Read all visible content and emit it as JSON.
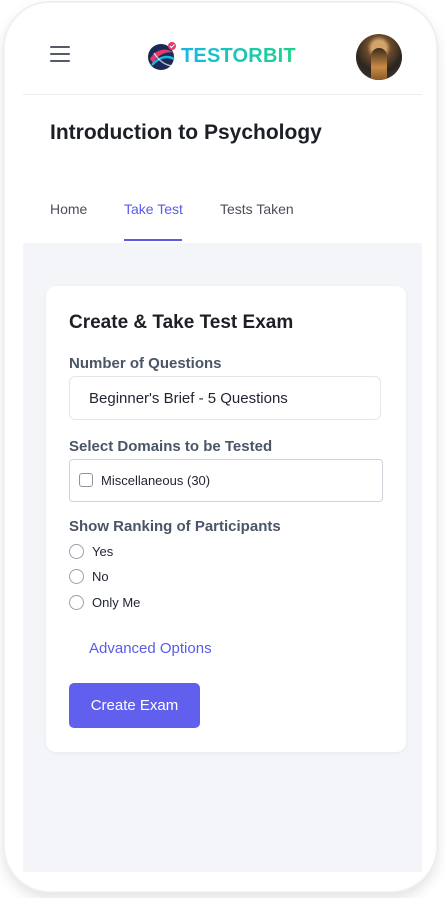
{
  "app": {
    "brand": "TESTORBIT"
  },
  "icons": {
    "menu": "hamburger-menu-icon",
    "logo": "testorbit-logo-icon",
    "avatar": "user-avatar"
  },
  "colors": {
    "accent": "#5b5be8",
    "button": "#6160ee",
    "logo_gradient_start": "#15b8e6",
    "logo_gradient_end": "#1fd38a"
  },
  "header": {
    "course_title": "Introduction to Psychology",
    "tabs": [
      {
        "label": "Home",
        "active": false
      },
      {
        "label": "Take Test",
        "active": true
      },
      {
        "label": "Tests Taken",
        "active": false
      }
    ]
  },
  "form": {
    "title": "Create & Take Test Exam",
    "questions_label": "Number of Questions",
    "questions_value": "Beginner's Brief - 5 Questions",
    "domains_label": "Select Domains to be Tested",
    "domains": [
      {
        "label": "Miscellaneous (30)",
        "checked": false
      }
    ],
    "ranking_label": "Show Ranking of Participants",
    "ranking_options": [
      {
        "label": "Yes",
        "selected": false
      },
      {
        "label": "No",
        "selected": false
      },
      {
        "label": "Only Me",
        "selected": false
      }
    ],
    "advanced_link": "Advanced Options",
    "submit_label": "Create Exam"
  }
}
